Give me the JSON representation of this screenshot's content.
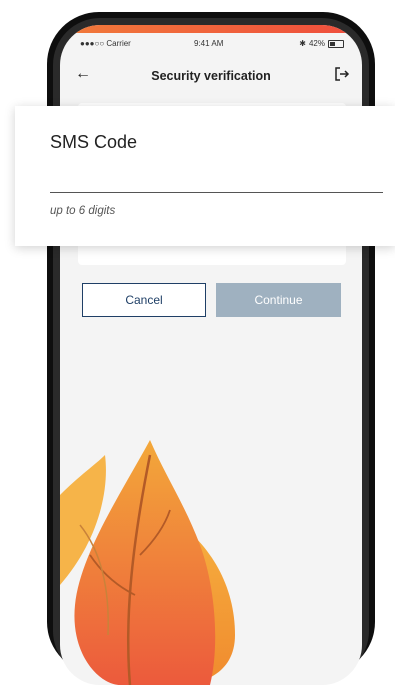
{
  "status_bar": {
    "carrier": "●●●○○ Carrier",
    "time": "9:41 AM",
    "battery": "42%"
  },
  "nav": {
    "title": "Security verification",
    "back_icon": "arrow-left-icon",
    "logout_icon": "logout-icon"
  },
  "sms_card": {
    "title": "SMS Code",
    "input_value": "",
    "helper": "up to 6 digits"
  },
  "buttons": {
    "cancel": "Cancel",
    "continue": "Continue"
  },
  "colors": {
    "accent_dark": "#1f3f66",
    "continue_disabled": "#9fb1c0",
    "flame_orange": "#f08a2e",
    "flame_red": "#ec5a3c"
  }
}
